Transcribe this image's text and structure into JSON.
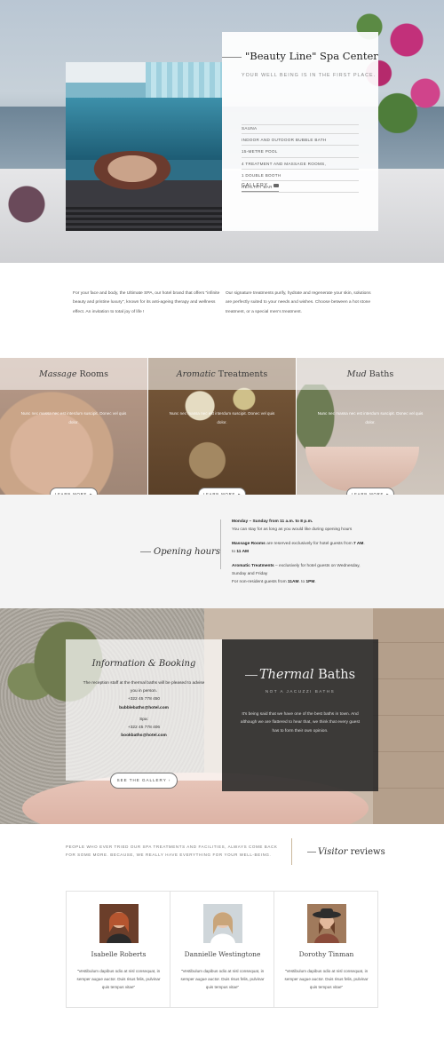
{
  "hero": {
    "title": "\"Beauty Line\" Spa Center",
    "subtitle": "YOUR WELL BEING IS IN THE FIRST PLACE.",
    "amenities": [
      "SAUNA",
      "INDOOR AND OUTDOOR BUBBLE BATH",
      "15-METRE POOL",
      "4 TREATMENT AND MASSAGE ROOMS,",
      "1 DOUBLE BOOTH",
      "HEALTHY BAR"
    ],
    "gallery_label": "GALLERY"
  },
  "intro": {
    "left": "For your face and body, the Ultimate SPA, our hotel brand that offers \"infinite beauty and pristine luxury\", known for its anti-ageing therapy and wellness effect.  An invitation to total joy of life !",
    "right": "Our signature treatments purify, hydrate and regenerate your skin, solutions are perfectly suited to your needs and wishes. Choose between  a hot stone treatment, or a special men's treatment."
  },
  "services": [
    {
      "title_italic": "Massage",
      "title_rest": " Rooms",
      "desc": "Nunc nec massa nec est interdum suscipit. Donec vel quis dolor.",
      "button": "LEARN MORE"
    },
    {
      "title_italic": "Aromatic",
      "title_rest": " Treatments",
      "desc": "Nunc nec massa nec est interdum suscipit. Donec vel quis dolor.",
      "button": "LEARN MORE"
    },
    {
      "title_italic": "Mud",
      "title_rest": " Baths",
      "desc": "Nunc nec massa nec est interdum suscipit. Donec vel quis dolor.",
      "button": "LEARN MORE"
    }
  ],
  "hours": {
    "title": "Opening hours",
    "line1_bold": "Monday – Sunday from 11 a.m. to 8 p.m.",
    "line2": "You can stay for as long as you would like during opening hours",
    "line3_bold": "Massage Rooms",
    "line3_rest": " are reserved exclusively for hotel guests from ",
    "line3_time1": "7 AM",
    "line3_to": ". to ",
    "line3_time2": "11 AM",
    "line4_bold": "Aromatic Treatments",
    "line4_rest": " – exclusively for hotel guests on Wednesday, Sunday and Friday",
    "line5_pre": "For non-resident guests from ",
    "line5_t1": "11AM",
    "line5_mid": ". to ",
    "line5_t2": "1PM",
    "line5_end": "."
  },
  "info": {
    "title_a": "Information",
    "title_amp": " & ",
    "title_b": "Booking",
    "body": "The reception staff at the thermal baths will be pleased to advise you in person.",
    "phone1": "+322 45 778 450",
    "email1": "bubblebaths@hotel.com",
    "spa_label": "Spa:",
    "phone2": "+322 45 778 406",
    "email2": "bookbaths@hotel.com",
    "gallery_button": "SEE THE GALLERY"
  },
  "thermal": {
    "title_italic": "Thermal",
    "title_rest": " Baths",
    "subtitle": "NOT A JACUZZI BATHS",
    "desc": "It's being said that we have one of the best baths in town. And although we are flattered to hear that, we think that every guest has to form their own opinion."
  },
  "reviews": {
    "intro": "PEOPLE WHO EVER TRIED OUR SPA TREATMENTS AND FACILITIES, ALWAYS COME BACK FOR SOME MORE. BECAUSE, WE REALLY HAVE EVERYTHING FOR YOUR WELL-BEING.",
    "title_italic": "Visitor",
    "title_rest": " reviews",
    "items": [
      {
        "name": "Isabelle Roberts",
        "quote": "\"Vestibulum dapibus odio at nisl consequat, in semper augue auctor. Duis risus felis, pulvinar quis tempus vitae\""
      },
      {
        "name": "Dannielle Westingtone",
        "quote": "\"Vestibulum dapibus odio at nisl consequat, in semper augue auctor. Duis risus felis, pulvinar quis tempus vitae\""
      },
      {
        "name": "Dorothy Tinman",
        "quote": "\"Vestibulum dapibus odio at nisl consequat, in semper augue auctor. Duis risus felis, pulvinar quis tempus vitae\""
      }
    ]
  },
  "icons": {
    "arrow": "arrow-right-icon",
    "camera": "camera-icon"
  },
  "colors": {
    "accent_line": "#cbb89d",
    "dark_card": "#2b2b2b",
    "section_gray": "#f4f4f4"
  }
}
